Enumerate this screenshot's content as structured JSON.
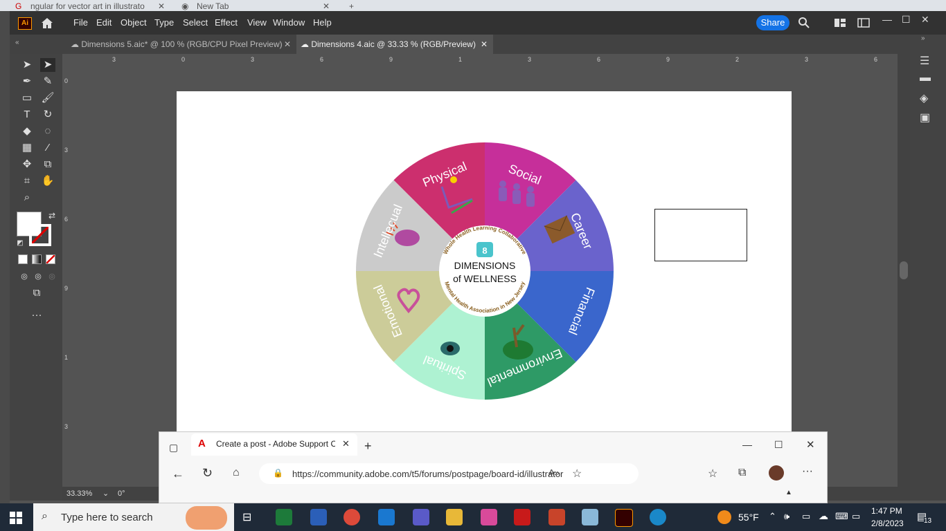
{
  "background_browser": {
    "tabs": [
      "ngular for vector art in illustrato",
      "New Tab"
    ]
  },
  "illustrator": {
    "logo": "Ai",
    "menu": [
      "File",
      "Edit",
      "Object",
      "Type",
      "Select",
      "Effect",
      "View",
      "Window",
      "Help"
    ],
    "share_label": "Share",
    "tabs": [
      {
        "label": "Dimensions 5.aic* @ 100 % (RGB/CPU Pixel Preview)",
        "active": false
      },
      {
        "label": "Dimensions 4.aic @ 33.33 % (RGB/Preview)",
        "active": true
      }
    ],
    "ruler_top": [
      "3",
      "0",
      "3",
      "6",
      "9",
      "1",
      "3",
      "6",
      "9",
      "2",
      "3",
      "6"
    ],
    "ruler_left": [
      "0",
      "3",
      "6",
      "9",
      "1",
      "3"
    ],
    "status": {
      "zoom": "33.33%",
      "rotation": "0°"
    }
  },
  "wheel": {
    "center": {
      "badge": "8",
      "line1": "DIMENSIONS",
      "line2": "of WELLNESS",
      "ring_top": "Whole Health Learning Collaborative",
      "ring_bottom": "Mental Health Association in New Jersey"
    },
    "segments": [
      {
        "label": "Physical",
        "color": "#cc2f6e"
      },
      {
        "label": "Social",
        "color": "#c62f9a"
      },
      {
        "label": "Career",
        "color": "#6a63cc"
      },
      {
        "label": "Financial",
        "color": "#3a66cc"
      },
      {
        "label": "Environmental",
        "color": "#2e9a66"
      },
      {
        "label": "Spiritual",
        "color": "#aef2d2"
      },
      {
        "label": "Emotional",
        "color": "#cccc99"
      },
      {
        "label": "Intellecual",
        "color": "#cbcbcb"
      }
    ]
  },
  "edge_browser": {
    "tab_title": "Create a post - Adobe Support C",
    "url": "https://community.adobe.com/t5/forums/postpage/board-id/illustrator"
  },
  "taskbar": {
    "search_placeholder": "Type here to search",
    "weather": "55°F",
    "time": "1:47 PM",
    "date": "2/8/2023",
    "notifications": "13"
  }
}
